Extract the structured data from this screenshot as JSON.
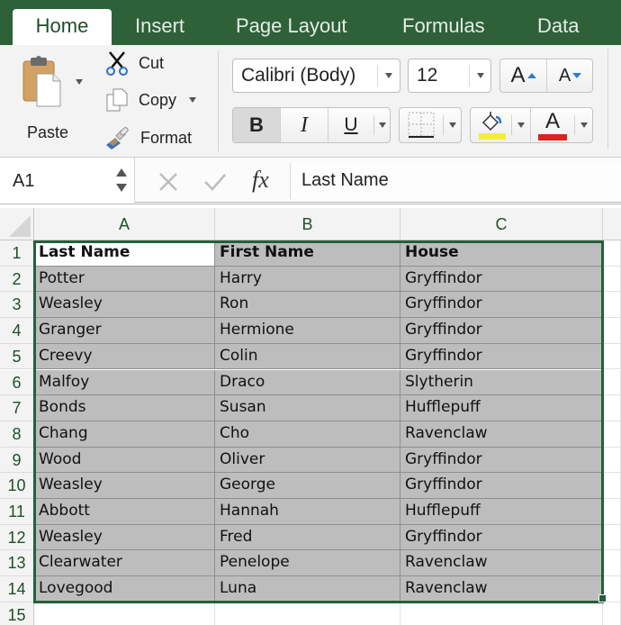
{
  "ribbon_tabs": [
    {
      "label": "Home",
      "active": true
    },
    {
      "label": "Insert",
      "active": false
    },
    {
      "label": "Page Layout",
      "active": false
    },
    {
      "label": "Formulas",
      "active": false
    },
    {
      "label": "Data",
      "active": false
    }
  ],
  "clipboard": {
    "paste_label": "Paste",
    "cut_label": "Cut",
    "copy_label": "Copy",
    "format_label": "Format"
  },
  "font": {
    "family": "Calibri (Body)",
    "size": "12",
    "increase_label": "A",
    "decrease_label": "A",
    "bold_label": "B",
    "italic_label": "I",
    "underline_label": "U",
    "font_color_label": "A",
    "fill_color": "#f4ee3a",
    "font_color": "#d9231f"
  },
  "formula_bar": {
    "name_box": "A1",
    "fx_label": "fx",
    "content": "Last Name"
  },
  "grid": {
    "columns": [
      "A",
      "B",
      "C"
    ],
    "row_numbers": [
      "1",
      "2",
      "3",
      "4",
      "5",
      "6",
      "7",
      "8",
      "9",
      "10",
      "11",
      "12",
      "13",
      "14",
      "15"
    ],
    "rows": [
      [
        "Last Name",
        "First Name",
        "House"
      ],
      [
        "Potter",
        "Harry",
        "Gryffindor"
      ],
      [
        "Weasley",
        "Ron",
        "Gryffindor"
      ],
      [
        "Granger",
        "Hermione",
        "Gryffindor"
      ],
      [
        "Creevy",
        "Colin",
        "Gryffindor"
      ],
      [
        "Malfoy",
        "Draco",
        "Slytherin"
      ],
      [
        "Bonds",
        "Susan",
        "Hufflepuff"
      ],
      [
        "Chang",
        "Cho",
        "Ravenclaw"
      ],
      [
        "Wood",
        "Oliver",
        "Gryffindor"
      ],
      [
        "Weasley",
        "George",
        "Gryffindor"
      ],
      [
        "Abbott",
        "Hannah",
        "Hufflepuff"
      ],
      [
        "Weasley",
        "Fred",
        "Gryffindor"
      ],
      [
        "Clearwater",
        "Penelope",
        "Ravenclaw"
      ],
      [
        "Lovegood",
        "Luna",
        "Ravenclaw"
      ]
    ],
    "selection": "A1:C14",
    "active_cell": "A1"
  },
  "colors": {
    "ribbon_green": "#2e6138",
    "selection_border": "#24603a",
    "selection_fill": "#bdbdbd"
  }
}
